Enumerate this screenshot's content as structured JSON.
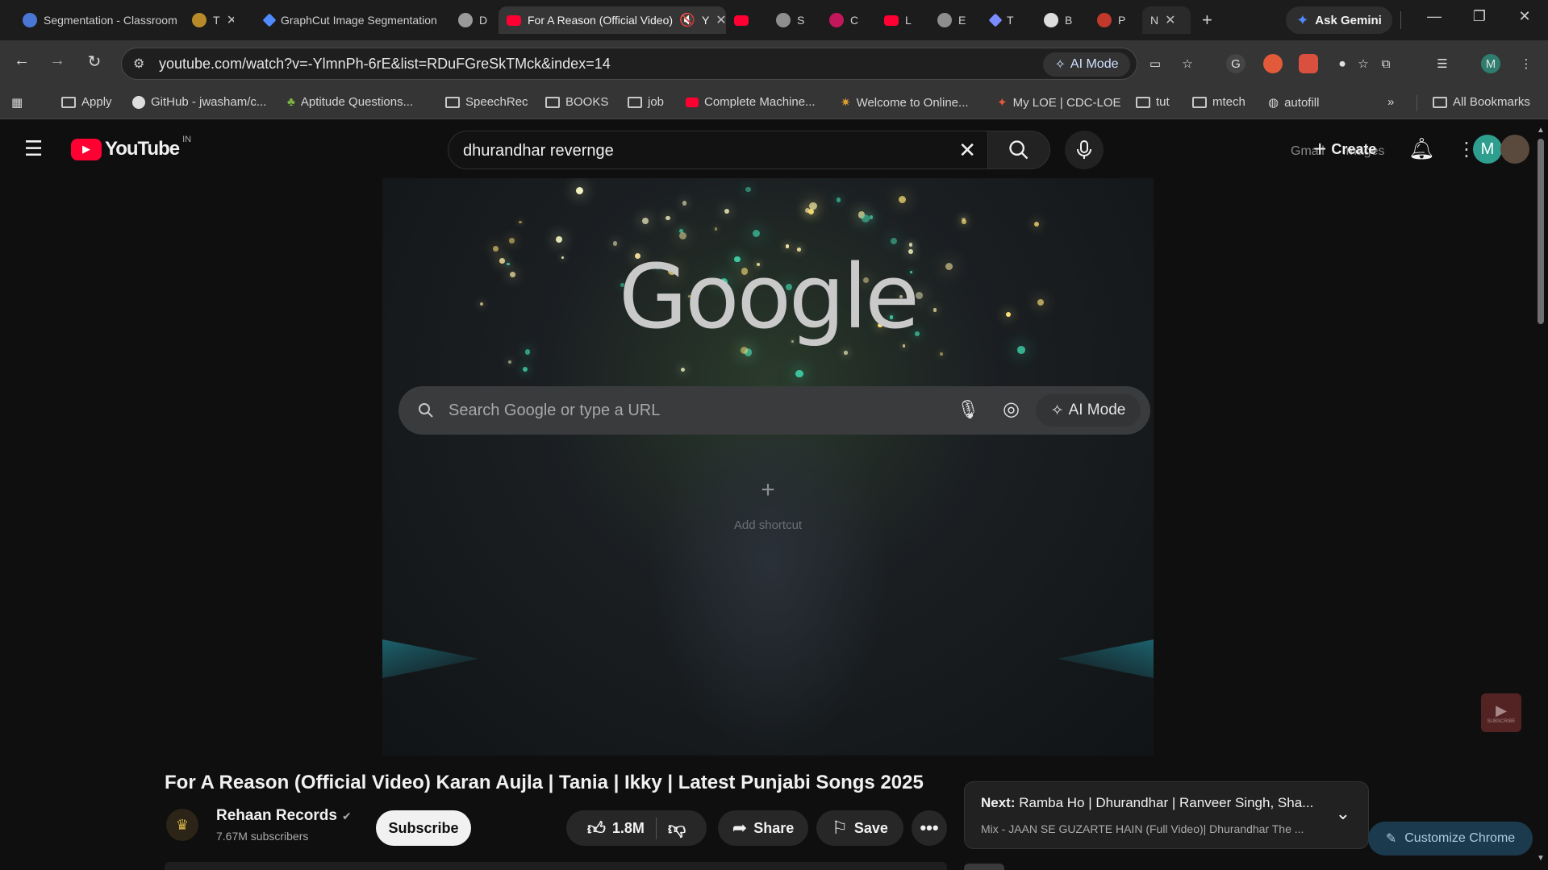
{
  "tabs": [
    {
      "label": "Segmentation - Classroom",
      "favicon_color": "#4a76d6"
    },
    {
      "label": "T",
      "favicon_color": "#b88a2a"
    },
    {
      "label": "GraphCut Image Segmentation",
      "favicon_color": "#888888"
    },
    {
      "label": "D",
      "favicon_color": "#9a9a9a"
    },
    {
      "label": "For A Reason (Official Video)",
      "favicon_color": "#ff0033",
      "active": true
    },
    {
      "label": "Y",
      "favicon_color": "#ff0033"
    },
    {
      "label": "S",
      "favicon_color": "#8e8e8e"
    },
    {
      "label": "C",
      "favicon_color": "#c2185b"
    },
    {
      "label": "L",
      "favicon_color": "#ff0033"
    },
    {
      "label": "E",
      "favicon_color": "#8e8e8e"
    },
    {
      "label": "T",
      "favicon_color": "#7b8cff"
    },
    {
      "label": "B",
      "favicon_color": "#dddddd"
    },
    {
      "label": "P",
      "favicon_color": "#c0392b"
    },
    {
      "label": "N",
      "favicon_color": "#555555"
    }
  ],
  "gemini": {
    "label": "Ask Gemini"
  },
  "omnibox": {
    "url": "youtube.com/watch?v=-YlmnPh-6rE&list=RDuFGreSkTMck&index=14",
    "ai_mode": "AI Mode"
  },
  "bookmarks": [
    {
      "label": "Apply",
      "type": "folder"
    },
    {
      "label": "GitHub - jwasham/c...",
      "type": "github"
    },
    {
      "label": "Aptitude Questions...",
      "type": "site"
    },
    {
      "label": "SpeechRec",
      "type": "folder"
    },
    {
      "label": "BOOKS",
      "type": "folder"
    },
    {
      "label": "job",
      "type": "folder"
    },
    {
      "label": "Complete Machine...",
      "type": "youtube"
    },
    {
      "label": "Welcome to Online...",
      "type": "site"
    },
    {
      "label": "My LOE | CDC-LOE",
      "type": "site"
    },
    {
      "label": "tut",
      "type": "folder"
    },
    {
      "label": "mtech",
      "type": "folder"
    },
    {
      "label": "autofill",
      "type": "site"
    }
  ],
  "all_bookmarks": "All Bookmarks",
  "youtube": {
    "logo_text": "YouTube",
    "region": "IN",
    "search_query": "dhurandhar revernge",
    "create_label": "Create",
    "header_overlap": {
      "gmail": "Gmail",
      "images": "Images"
    },
    "avatar_letter": "M"
  },
  "ntp": {
    "logo": "Google",
    "search_placeholder": "Search Google or type a URL",
    "ai_mode": "AI Mode",
    "add_shortcut": "Add shortcut"
  },
  "video": {
    "title": "For A Reason (Official Video) Karan Aujla | Tania | Ikky | Latest Punjabi Songs 2025",
    "channel": "Rehaan Records",
    "subscribers": "7.67M subscribers",
    "subscribe_label": "Subscribe",
    "likes": "1.8M",
    "share_label": "Share",
    "save_label": "Save"
  },
  "up_next": {
    "prefix": "Next:",
    "title": "Ramba Ho | Dhurandhar | Ranveer Singh, Sha...",
    "subtitle": "Mix - JAAN SE GUZARTE HAIN (Full Video)| Dhurandhar The ..."
  },
  "customize_chrome": "Customize Chrome",
  "watermark": "SUBSCRIBE",
  "colors": {
    "youtube_red": "#ff0033",
    "accent_blue": "#8ab4f8",
    "gemini_blue": "#4f8bff"
  }
}
